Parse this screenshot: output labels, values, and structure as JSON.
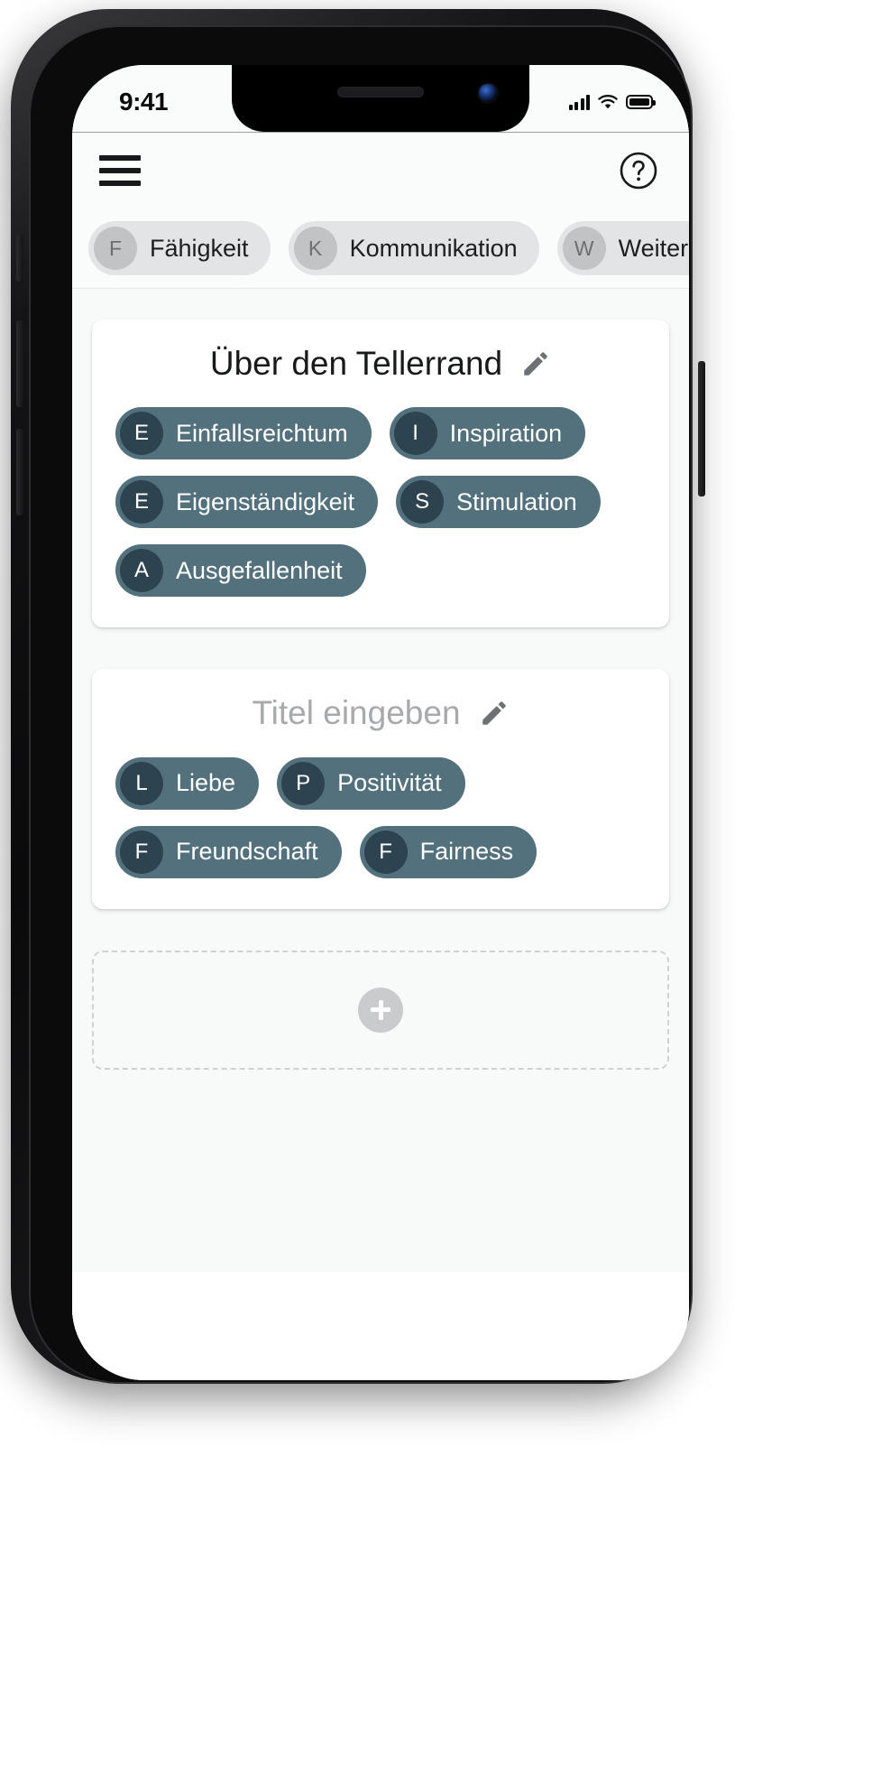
{
  "status_bar": {
    "time": "9:41",
    "signal_icon": "cellular-signal-icon",
    "wifi_icon": "wifi-icon",
    "battery_icon": "battery-full-icon"
  },
  "appbar": {
    "menu_icon": "hamburger-menu-icon",
    "help_icon": "help-circle-icon"
  },
  "category_strip": {
    "chips": [
      {
        "initial": "F",
        "label": "Fähigkeit"
      },
      {
        "initial": "K",
        "label": "Kommunikation"
      },
      {
        "initial": "W",
        "label": "Weiterentwicklung"
      }
    ]
  },
  "cards": [
    {
      "title": "Über den Tellerrand",
      "title_is_placeholder": false,
      "edit_icon": "pencil-edit-icon",
      "tags": [
        {
          "initial": "E",
          "label": "Einfallsreichtum"
        },
        {
          "initial": "I",
          "label": "Inspiration"
        },
        {
          "initial": "E",
          "label": "Eigenständigkeit"
        },
        {
          "initial": "S",
          "label": "Stimulation"
        },
        {
          "initial": "A",
          "label": "Ausgefallenheit"
        }
      ]
    },
    {
      "title": "Titel eingeben",
      "title_is_placeholder": true,
      "edit_icon": "pencil-edit-icon",
      "tags": [
        {
          "initial": "L",
          "label": "Liebe"
        },
        {
          "initial": "P",
          "label": "Positivität"
        },
        {
          "initial": "F",
          "label": "Freundschaft"
        },
        {
          "initial": "F",
          "label": "Fairness"
        }
      ]
    }
  ],
  "add_card": {
    "icon": "plus-icon"
  },
  "colors": {
    "tag_background": "#53707d",
    "tag_avatar": "#2d4450",
    "category_chip_background": "#e3e4e5",
    "category_chip_avatar": "#c2c3c4",
    "app_background": "#f8f9f9",
    "card_background": "#ffffff",
    "placeholder_text": "#a7a9ab",
    "hairline": "#3f5a68"
  }
}
